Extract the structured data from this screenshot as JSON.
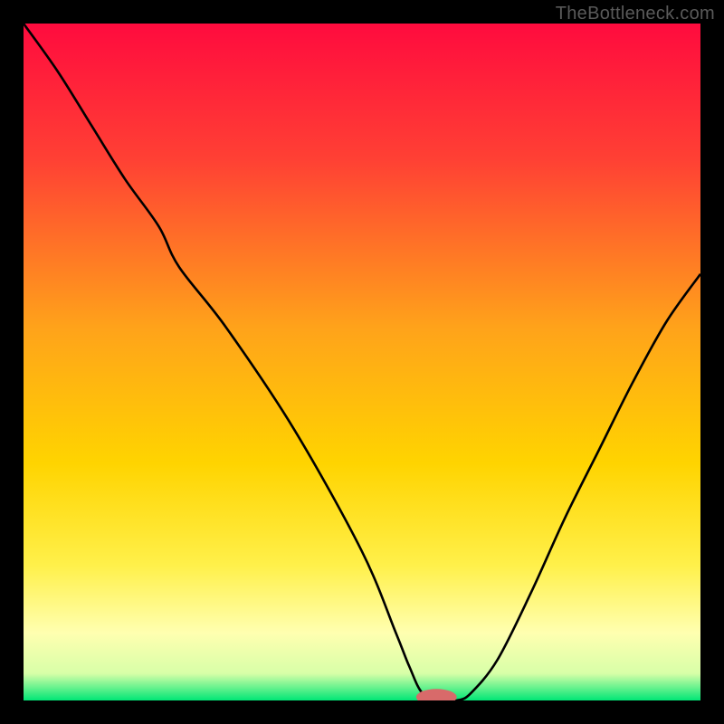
{
  "watermark": "TheBottleneck.com",
  "chart_data": {
    "type": "line",
    "title": "",
    "xlabel": "",
    "ylabel": "",
    "xlim": [
      0,
      100
    ],
    "ylim": [
      0,
      100
    ],
    "x": [
      0,
      5,
      10,
      15,
      20,
      23,
      30,
      40,
      50,
      55,
      57,
      59,
      62,
      64,
      66,
      70,
      75,
      80,
      85,
      90,
      95,
      100
    ],
    "values": [
      100,
      93,
      85,
      77,
      70,
      64,
      55,
      40,
      22,
      10,
      5,
      1,
      0,
      0,
      1,
      6,
      16,
      27,
      37,
      47,
      56,
      63
    ],
    "gradient_stops": [
      {
        "pos": 0.0,
        "color": "#ff0b3e"
      },
      {
        "pos": 0.2,
        "color": "#ff4034"
      },
      {
        "pos": 0.45,
        "color": "#ffa31a"
      },
      {
        "pos": 0.65,
        "color": "#ffd400"
      },
      {
        "pos": 0.8,
        "color": "#fff04a"
      },
      {
        "pos": 0.9,
        "color": "#ffffb0"
      },
      {
        "pos": 0.96,
        "color": "#d8ffa8"
      },
      {
        "pos": 1.0,
        "color": "#00e676"
      }
    ],
    "marker": {
      "x": 61,
      "y": 0.5,
      "rx": 3,
      "ry": 1.2,
      "color": "#d86a6a"
    }
  }
}
